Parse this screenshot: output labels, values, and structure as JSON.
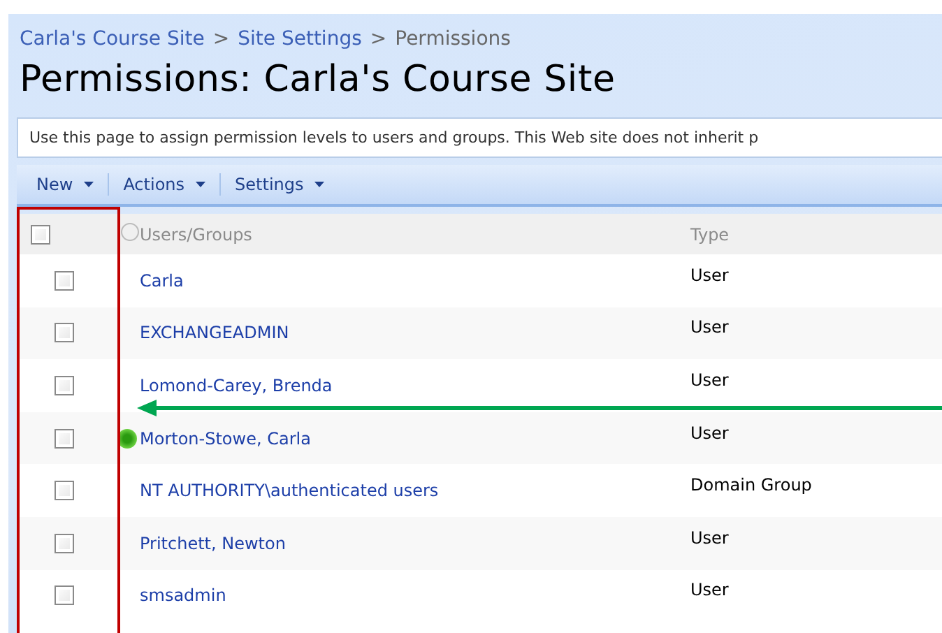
{
  "breadcrumb": [
    {
      "label": "Carla's Course Site",
      "link": true
    },
    {
      "label": "Site Settings",
      "link": true
    },
    {
      "label": "Permissions",
      "link": false
    }
  ],
  "breadcrumb_separator": ">",
  "title": "Permissions: Carla's Course Site",
  "description": "Use this page to assign permission levels to users and groups. This Web site does not inherit p",
  "toolbar": [
    {
      "label": "New",
      "divider_after": true
    },
    {
      "label": "Actions",
      "divider_after": true
    },
    {
      "label": "Settings",
      "divider_after": false
    }
  ],
  "table": {
    "columns": [
      "Users/Groups",
      "Type"
    ],
    "select_all_checked": false,
    "rows": [
      {
        "name": "Carla",
        "type": "User",
        "checked": false,
        "online": false
      },
      {
        "name": "EXCHANGEADMIN",
        "type": "User",
        "checked": false,
        "online": false
      },
      {
        "name": "Lomond-Carey, Brenda",
        "type": "User",
        "checked": false,
        "online": false
      },
      {
        "name": "Morton-Stowe, Carla",
        "type": "User",
        "checked": false,
        "online": true
      },
      {
        "name": "NT AUTHORITY\\authenticated users",
        "type": "Domain Group",
        "checked": false,
        "online": false
      },
      {
        "name": "Pritchett, Newton",
        "type": "User",
        "checked": false,
        "online": false
      },
      {
        "name": "smsadmin",
        "type": "User",
        "checked": false,
        "online": false
      }
    ]
  },
  "annotations": [
    {
      "kind": "box",
      "color": "#c00000"
    },
    {
      "kind": "arrow",
      "color": "#00a651"
    }
  ]
}
